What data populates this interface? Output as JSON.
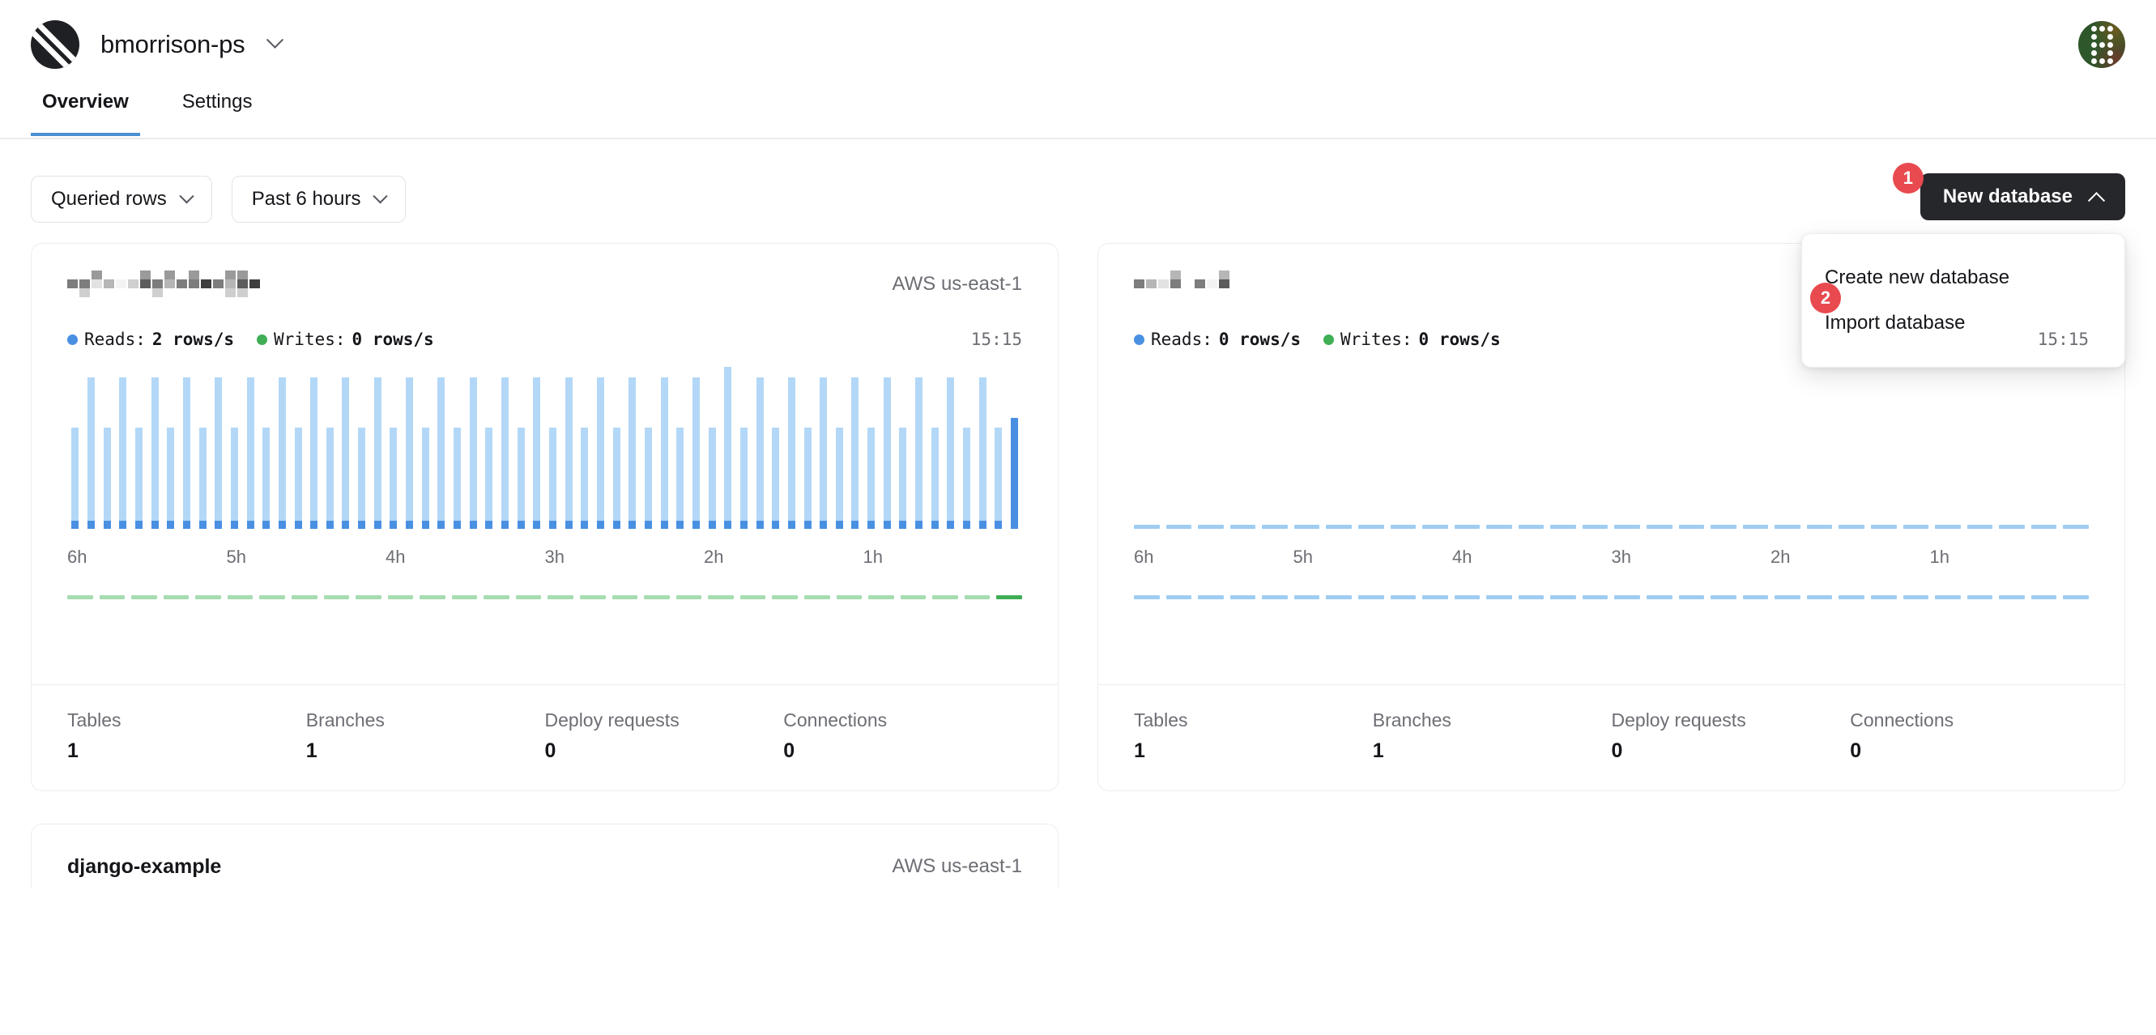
{
  "header": {
    "org_name": "bmorrison-ps",
    "org_switch_icon": "chevron-down-icon",
    "logo_icon": "planetscale-logo-icon",
    "avatar_icon": "user-avatar"
  },
  "tabs": [
    {
      "label": "Overview",
      "active": true
    },
    {
      "label": "Settings",
      "active": false
    }
  ],
  "toolbar": {
    "metric_filter": "Queried rows",
    "time_filter": "Past 6 hours",
    "new_database_button": "New database",
    "new_database_chevron": "chevron-up-icon",
    "menu": {
      "items": [
        "Create new database",
        "Import database"
      ]
    },
    "badges": {
      "one": "1",
      "two": "2"
    }
  },
  "cards": [
    {
      "name_redacted": true,
      "name": "",
      "region": "AWS us-east-1",
      "reads_label": "Reads:",
      "reads_value": "2 rows/s",
      "writes_label": "Writes:",
      "writes_value": "0 rows/s",
      "timestamp": "15:15",
      "axis": [
        "6h",
        "5h",
        "4h",
        "3h",
        "2h",
        "1h"
      ],
      "stats": [
        {
          "key": "Tables",
          "value": "1"
        },
        {
          "key": "Branches",
          "value": "1"
        },
        {
          "key": "Deploy requests",
          "value": "0"
        },
        {
          "key": "Connections",
          "value": "0"
        }
      ]
    },
    {
      "name_redacted": true,
      "name": "",
      "region": "",
      "reads_label": "Reads:",
      "reads_value": "0 rows/s",
      "writes_label": "Writes:",
      "writes_value": "0 rows/s",
      "timestamp": "15:15",
      "axis": [
        "6h",
        "5h",
        "4h",
        "3h",
        "2h",
        "1h"
      ],
      "stats": [
        {
          "key": "Tables",
          "value": "1"
        },
        {
          "key": "Branches",
          "value": "1"
        },
        {
          "key": "Deploy requests",
          "value": "0"
        },
        {
          "key": "Connections",
          "value": "0"
        }
      ]
    }
  ],
  "peek_card": {
    "name": "django-example",
    "region": "AWS us-east-1"
  },
  "colors": {
    "accent_blue": "#4a90e2",
    "bar_light": "#b3d8f7",
    "green": "#3fae55",
    "green_light": "#a7dcb1",
    "badge_red": "#e84a4f",
    "button_dark": "#26272b",
    "tab_underline": "#4a8fd0"
  },
  "chart_data": [
    {
      "type": "bar",
      "title": "Queried rows - card 1",
      "xlabel": "",
      "ylabel": "rows/s",
      "xticks": [
        "6h",
        "5h",
        "4h",
        "3h",
        "2h",
        "1h"
      ],
      "series": [
        {
          "name": "Reads",
          "color": "#4a90e2",
          "values": [
            2,
            3,
            2,
            3,
            2,
            3,
            2,
            3,
            2,
            3,
            2,
            3,
            2,
            3,
            2,
            3,
            2,
            3,
            2,
            3,
            2,
            3,
            2,
            3,
            2,
            3,
            2,
            3,
            2,
            3,
            2,
            3,
            2,
            3,
            2,
            3,
            2,
            3,
            2,
            3,
            2,
            3.2,
            2,
            3,
            2,
            3,
            2,
            3,
            2,
            3,
            2,
            3,
            2,
            3,
            2,
            3,
            2,
            3,
            2,
            2.2
          ]
        },
        {
          "name": "Writes",
          "color": "#3fae55",
          "values": [
            0,
            0,
            0,
            0,
            0,
            0,
            0,
            0,
            0,
            0,
            0,
            0,
            0,
            0,
            0,
            0,
            0,
            0,
            0,
            0,
            0,
            0,
            0,
            0,
            0,
            0,
            0,
            0,
            0,
            0,
            0,
            0,
            0,
            0,
            0,
            0,
            0,
            0,
            0,
            0,
            0,
            0,
            0,
            0,
            0,
            0,
            0,
            0,
            0,
            0,
            0,
            0,
            0,
            0,
            0,
            0,
            0,
            0,
            0,
            0
          ]
        }
      ]
    },
    {
      "type": "bar",
      "title": "Queried rows - card 2",
      "xlabel": "",
      "ylabel": "rows/s",
      "xticks": [
        "6h",
        "5h",
        "4h",
        "3h",
        "2h",
        "1h"
      ],
      "series": [
        {
          "name": "Reads",
          "color": "#4a90e2",
          "values": [
            0,
            0,
            0,
            0,
            0,
            0,
            0,
            0,
            0,
            0,
            0,
            0,
            0,
            0,
            0,
            0,
            0,
            0,
            0,
            0,
            0,
            0,
            0,
            0,
            0,
            0,
            0,
            0,
            0,
            0,
            0,
            0,
            0,
            0,
            0,
            0,
            0,
            0,
            0,
            0,
            0,
            0,
            0,
            0,
            0,
            0,
            0,
            0,
            0,
            0,
            0,
            0,
            0,
            0,
            0,
            0,
            0,
            0,
            0,
            0
          ]
        },
        {
          "name": "Writes",
          "color": "#3fae55",
          "values": [
            0,
            0,
            0,
            0,
            0,
            0,
            0,
            0,
            0,
            0,
            0,
            0,
            0,
            0,
            0,
            0,
            0,
            0,
            0,
            0,
            0,
            0,
            0,
            0,
            0,
            0,
            0,
            0,
            0,
            0,
            0,
            0,
            0,
            0,
            0,
            0,
            0,
            0,
            0,
            0,
            0,
            0,
            0,
            0,
            0,
            0,
            0,
            0,
            0,
            0,
            0,
            0,
            0,
            0,
            0,
            0,
            0,
            0,
            0,
            0
          ]
        }
      ]
    }
  ]
}
